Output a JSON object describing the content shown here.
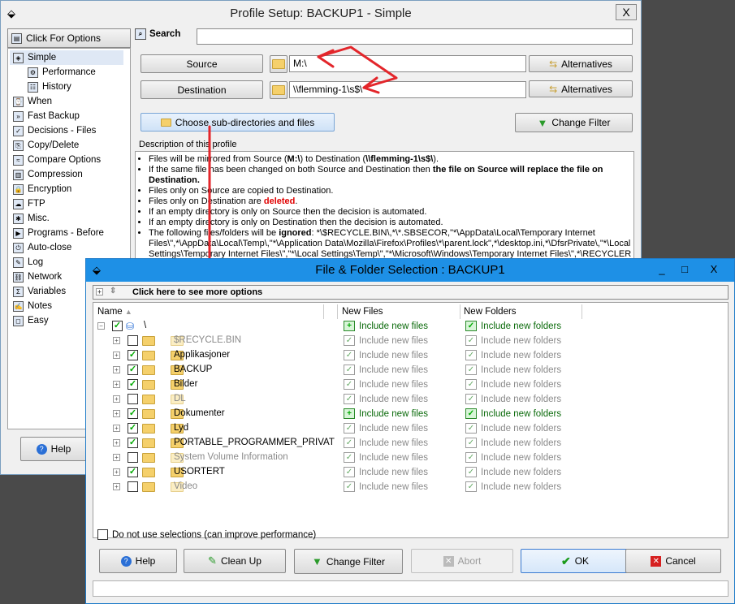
{
  "profile_window": {
    "title": "Profile Setup: BACKUP1 - Simple",
    "close_glyph": "X",
    "options_header": "Click For Options",
    "nav_items": [
      {
        "label": "Simple",
        "icon": "simple-icon"
      },
      {
        "label": "Performance",
        "icon": "performance-icon"
      },
      {
        "label": "History",
        "icon": "history-icon"
      },
      {
        "label": "When",
        "icon": "when-icon"
      },
      {
        "label": "Fast Backup",
        "icon": "fast-backup-icon"
      },
      {
        "label": "Decisions - Files",
        "icon": "decisions-icon"
      },
      {
        "label": "Copy/Delete",
        "icon": "copy-delete-icon"
      },
      {
        "label": "Compare Options",
        "icon": "compare-icon"
      },
      {
        "label": "Compression",
        "icon": "compression-icon"
      },
      {
        "label": "Encryption",
        "icon": "encryption-icon"
      },
      {
        "label": "FTP",
        "icon": "ftp-icon"
      },
      {
        "label": "Misc.",
        "icon": "misc-icon"
      },
      {
        "label": "Programs - Before",
        "icon": "programs-icon"
      },
      {
        "label": "Auto-close",
        "icon": "auto-close-icon"
      },
      {
        "label": "Log",
        "icon": "log-icon"
      },
      {
        "label": "Network",
        "icon": "network-icon"
      },
      {
        "label": "Variables",
        "icon": "variables-icon"
      },
      {
        "label": "Notes",
        "icon": "notes-icon"
      },
      {
        "label": "Easy",
        "icon": "easy-icon"
      }
    ],
    "help_label": "Help",
    "search_label": "Search",
    "search_value": "",
    "source_label": "Source",
    "source_value": "M:\\",
    "destination_label": "Destination",
    "destination_value": "\\\\flemming-1\\s$\\",
    "alternatives_label": "Alternatives",
    "choose_subdirs_label": "Choose sub-directories and files",
    "change_filter_label": "Change Filter",
    "description_header": "Description of this profile",
    "description": {
      "line1_a": "Files will be mirrored from Source (",
      "line1_b": "M:\\",
      "line1_c": ") to Destination (",
      "line1_d": "\\\\flemming-1\\s$\\",
      "line1_e": ").",
      "line2_a": "If the same file has been changed on both Source and Destination then ",
      "line2_b": "the file on Source will replace the file on Destination.",
      "line3": "Files only on Source are copied to Destination.",
      "line4_a": "Files only on Destination are ",
      "line4_b": "deleted",
      "line4_c": ".",
      "line5": "If an empty directory is only on Source then the decision is automated.",
      "line6": "If an empty directory is only on Destination then the decision is automated.",
      "line7_a": "The following files/folders will be ",
      "line7_b": "ignored",
      "line7_c": ": *\\$RECYCLE.BIN\\,*\\*.SBSECOR,\"*\\AppData\\Local\\Temporary Internet Files\\\",*\\AppData\\Local\\Temp\\,\"*\\Application Data\\Mozilla\\Firefox\\Profiles\\*\\parent.lock\",*\\desktop.ini,*\\DfsrPrivate\\,\"*\\Local Settings\\Temporary Internet Files\\\",\"*\\Local Settings\\Temp\\\",\"*\\Microsoft\\Windows\\Temporary Internet Files\\\",*\\RECYCLER"
    }
  },
  "selection_window": {
    "title": "File & Folder Selection : BACKUP1",
    "more_options": "Click here to see more options",
    "col_name": "Name",
    "col_new_files": "New Files",
    "col_new_folders": "New Folders",
    "root_label": "\\",
    "include_files": "Include new files",
    "include_folders": "Include new folders",
    "rows": [
      {
        "name": "$RECYCLE.BIN",
        "checked": false,
        "hidden": true
      },
      {
        "name": "Applikasjoner",
        "checked": true,
        "hidden": false
      },
      {
        "name": "BACKUP",
        "checked": true,
        "hidden": false
      },
      {
        "name": "Bilder",
        "checked": true,
        "hidden": false
      },
      {
        "name": "DL",
        "checked": false,
        "hidden": true
      },
      {
        "name": "Dokumenter",
        "checked": true,
        "hidden": false,
        "active": true
      },
      {
        "name": "Lyd",
        "checked": true,
        "hidden": false
      },
      {
        "name": "PORTABLE_PROGRAMMER_PRIVAT",
        "checked": true,
        "hidden": false
      },
      {
        "name": "System Volume Information",
        "checked": false,
        "hidden": true
      },
      {
        "name": "USORTERT",
        "checked": true,
        "hidden": false
      },
      {
        "name": "Video",
        "checked": false,
        "hidden": true
      }
    ],
    "no_selections_label": "Do not use selections (can improve performance)",
    "buttons": {
      "help": "Help",
      "cleanup": "Clean Up",
      "change_filter": "Change Filter",
      "abort": "Abort",
      "ok": "OK",
      "cancel": "Cancel"
    },
    "window_controls": {
      "minimize": "_",
      "maximize": "□",
      "close": "X"
    }
  },
  "colors": {
    "titlebar_active": "#1e90e6",
    "arrow": "#e3262b",
    "delete_red": "#e00000"
  }
}
